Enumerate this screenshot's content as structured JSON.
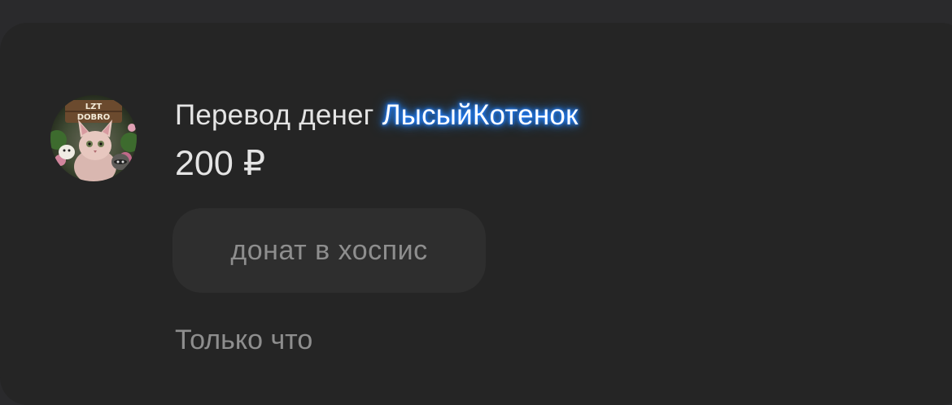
{
  "transfer": {
    "title_prefix": "Перевод денег ",
    "recipient": "ЛысыйКотенок",
    "amount": "200 ₽",
    "comment": "донат в хоспис",
    "time": "Только что"
  },
  "avatar": {
    "icon": "cat-avatar-icon",
    "logo_text_line1": "LZT",
    "logo_text_line2": "DOBRO"
  },
  "colors": {
    "background": "#2a2a2c",
    "card": "#252525",
    "comment_bubble": "#2e2e2e",
    "nick_glow": "#1f7dff"
  }
}
